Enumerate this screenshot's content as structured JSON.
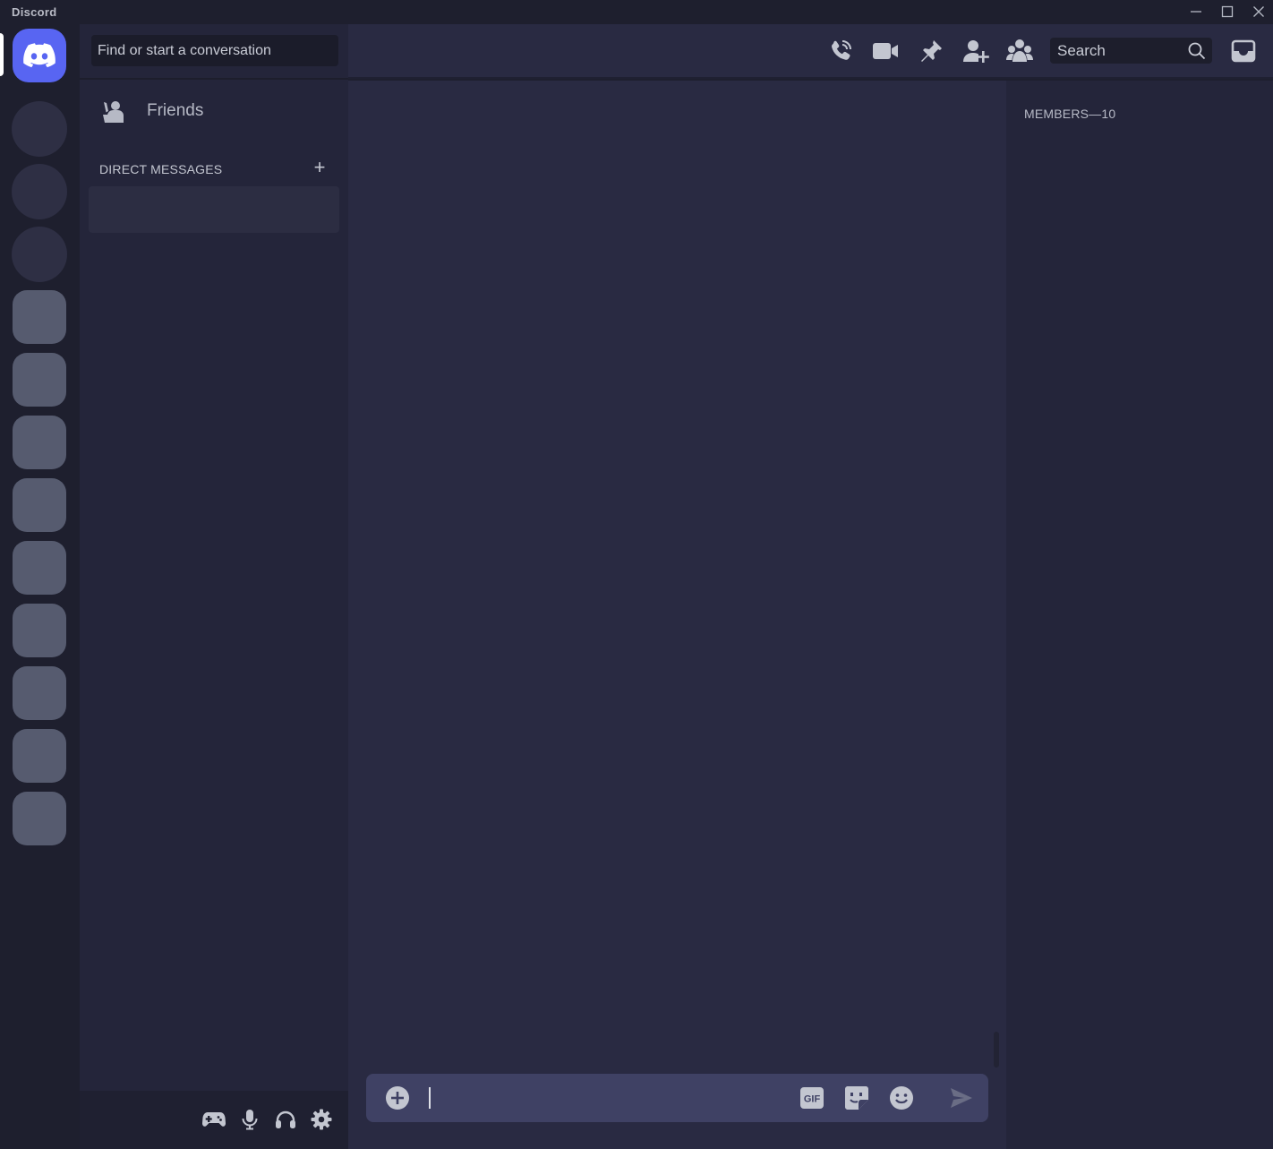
{
  "window": {
    "title": "Discord",
    "controls": [
      "minimize-icon",
      "maximize-icon",
      "close-icon"
    ]
  },
  "guilds": {
    "home_icon": "discord-logo-icon",
    "accent": "#5865f2",
    "circle_count": 3,
    "square_count": 9
  },
  "sidebar": {
    "search_placeholder": "Find or start a conversation",
    "friends_label": "Friends",
    "dm_header": "DIRECT MESSAGES",
    "dm_add_label": "+"
  },
  "user_panel": {
    "buttons": [
      "activity-controller-icon",
      "microphone-icon",
      "headphones-icon",
      "settings-gear-icon"
    ]
  },
  "header": {
    "buttons": [
      "voice-call-icon",
      "video-call-icon",
      "pinned-messages-icon",
      "add-friend-icon",
      "member-list-icon"
    ],
    "search_label": "Search",
    "inbox_icon": "inbox-icon"
  },
  "composer": {
    "value": "",
    "buttons": [
      "attach-plus-icon",
      "gif-icon",
      "sticker-icon",
      "emoji-icon",
      "send-icon"
    ],
    "gif_label": "GIF"
  },
  "members": {
    "header": "MEMBERS—10"
  },
  "colors": {
    "app_bg": "#1e1f2e",
    "sidebar_bg": "#24253a",
    "chat_bg": "#292a42",
    "composer_bg": "#3f4164"
  }
}
